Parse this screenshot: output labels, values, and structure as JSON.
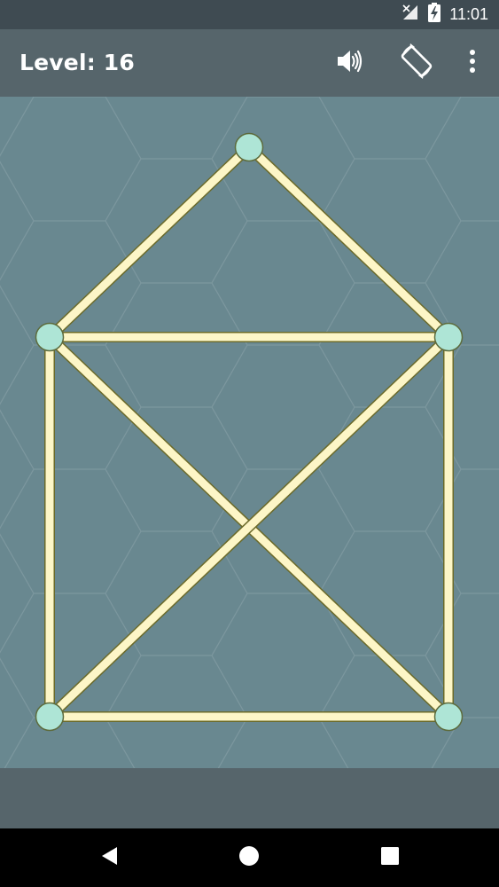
{
  "status_bar": {
    "time": "11:01",
    "icons": [
      "no-signal-icon",
      "battery-charging-icon"
    ]
  },
  "app_bar": {
    "level_text": "Level: 16",
    "actions": [
      "sound-icon",
      "screen-rotation-icon",
      "more-options-icon"
    ]
  },
  "puzzle": {
    "nodes": [
      {
        "id": "apex"
      },
      {
        "id": "mid-left"
      },
      {
        "id": "mid-right"
      },
      {
        "id": "bottom-left"
      },
      {
        "id": "bottom-right"
      }
    ],
    "edges": [
      [
        "apex",
        "mid-left"
      ],
      [
        "apex",
        "mid-right"
      ],
      [
        "mid-left",
        "mid-right"
      ],
      [
        "mid-left",
        "bottom-left"
      ],
      [
        "mid-right",
        "bottom-right"
      ],
      [
        "mid-left",
        "bottom-right"
      ],
      [
        "mid-right",
        "bottom-left"
      ],
      [
        "bottom-left",
        "bottom-right"
      ]
    ],
    "colors": {
      "background": "#698890",
      "hex_grid": "#7c979e",
      "edge_fill": "#fdf6c7",
      "edge_outline": "#6b6a2a",
      "node_fill": "#aee5d6",
      "node_outline": "#5d6b3d"
    }
  },
  "nav_bar": {
    "buttons": [
      "back-icon",
      "home-icon",
      "recents-icon"
    ]
  }
}
